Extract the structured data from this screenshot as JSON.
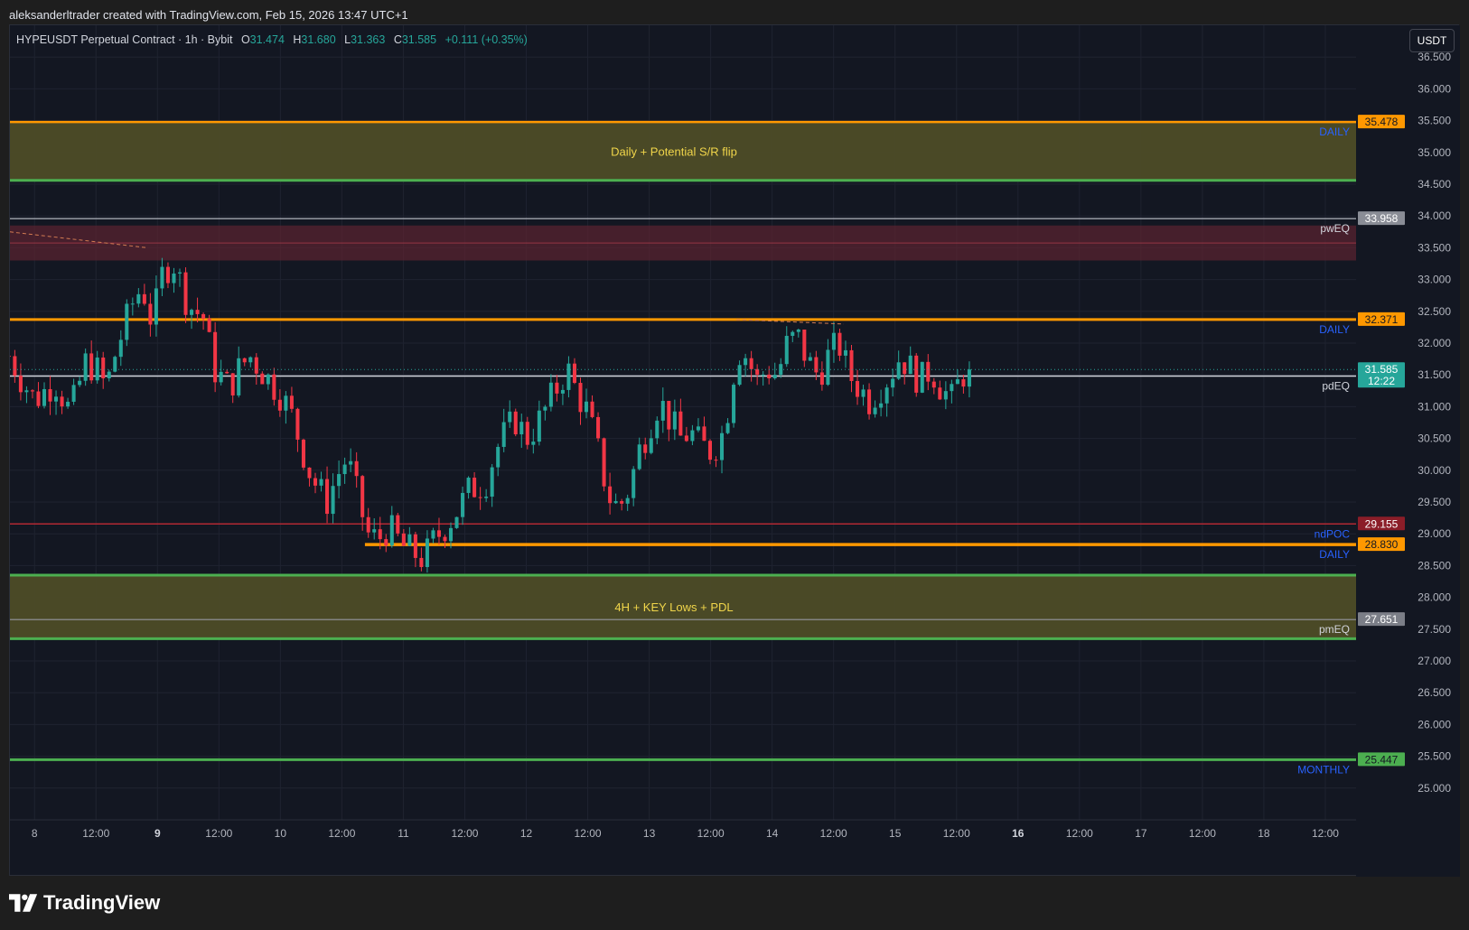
{
  "caption": "aleksanderltrader created with TradingView.com, Feb 15, 2026 13:47 UTC+1",
  "header": {
    "symbol": "HYPEUSDT Perpetual Contract · 1h · Bybit",
    "open_label": "O",
    "open": "31.474",
    "high_label": "H",
    "high": "31.680",
    "low_label": "L",
    "low": "31.363",
    "close_label": "C",
    "close": "31.585",
    "change": "+0.111 (+0.35%)"
  },
  "currency_button": "USDT",
  "brand": {
    "name": "TradingView",
    "icon": "tradingview-logo-icon"
  },
  "colors": {
    "background": "#131722",
    "up": "#26a69a",
    "down": "#f23645",
    "orange": "#ff9800",
    "green": "#4caf50",
    "zone": "#4d4c27",
    "red_zone": "#4a2028",
    "ndpoc": "#8b1d28",
    "daily_text": "#2962ff"
  },
  "chart_data": {
    "type": "candlestick",
    "title": "HYPEUSDT Perpetual Contract · 1h · Bybit",
    "timeframe": "1h",
    "ylim": [
      24.5,
      37.0
    ],
    "y_ticks": [
      "36.500",
      "36.000",
      "35.500",
      "35.000",
      "34.500",
      "34.000",
      "33.500",
      "33.000",
      "32.500",
      "32.000",
      "31.500",
      "31.000",
      "30.500",
      "30.000",
      "29.500",
      "29.000",
      "28.500",
      "28.000",
      "27.500",
      "27.000",
      "26.500",
      "26.000",
      "25.500",
      "25.000"
    ],
    "x_ticks": [
      {
        "label": "8",
        "t": 0,
        "bold": false
      },
      {
        "label": "12:00",
        "t": 12,
        "bold": false
      },
      {
        "label": "9",
        "t": 24,
        "bold": true
      },
      {
        "label": "12:00",
        "t": 36,
        "bold": false
      },
      {
        "label": "10",
        "t": 48,
        "bold": false
      },
      {
        "label": "12:00",
        "t": 60,
        "bold": false
      },
      {
        "label": "11",
        "t": 72,
        "bold": false
      },
      {
        "label": "12:00",
        "t": 84,
        "bold": false
      },
      {
        "label": "12",
        "t": 96,
        "bold": false
      },
      {
        "label": "12:00",
        "t": 108,
        "bold": false
      },
      {
        "label": "13",
        "t": 120,
        "bold": false
      },
      {
        "label": "12:00",
        "t": 132,
        "bold": false
      },
      {
        "label": "14",
        "t": 144,
        "bold": false
      },
      {
        "label": "12:00",
        "t": 156,
        "bold": false
      },
      {
        "label": "15",
        "t": 168,
        "bold": false
      },
      {
        "label": "12:00",
        "t": 180,
        "bold": false
      },
      {
        "label": "16",
        "t": 192,
        "bold": true
      },
      {
        "label": "12:00",
        "t": 204,
        "bold": false
      },
      {
        "label": "17",
        "t": 216,
        "bold": false
      },
      {
        "label": "12:00",
        "t": 228,
        "bold": false
      },
      {
        "label": "18",
        "t": 240,
        "bold": false
      },
      {
        "label": "12:00",
        "t": 252,
        "bold": false
      }
    ],
    "x_range_hours": [
      -4.8,
      258
    ],
    "anchors": [
      [
        -5,
        31.8
      ],
      [
        -3,
        31.5
      ],
      [
        0,
        31.1
      ],
      [
        4,
        31.4
      ],
      [
        7,
        30.9
      ],
      [
        10,
        31.7
      ],
      [
        12,
        31.6
      ],
      [
        14,
        31.3
      ],
      [
        16,
        31.9
      ],
      [
        19,
        32.6
      ],
      [
        21,
        32.9
      ],
      [
        23,
        32.3
      ],
      [
        25,
        33.1
      ],
      [
        27,
        33.3
      ],
      [
        30,
        32.6
      ],
      [
        33,
        32.4
      ],
      [
        35,
        31.6
      ],
      [
        38,
        31.3
      ],
      [
        40,
        31.6
      ],
      [
        42,
        31.8
      ],
      [
        45,
        31.5
      ],
      [
        48,
        31.2
      ],
      [
        50,
        30.9
      ],
      [
        52,
        30.4
      ],
      [
        54,
        29.9
      ],
      [
        57,
        29.5
      ],
      [
        59,
        29.9
      ],
      [
        61,
        30.2
      ],
      [
        63,
        29.6
      ],
      [
        65,
        29.0
      ],
      [
        67,
        28.9
      ],
      [
        69,
        29.1
      ],
      [
        72,
        28.8
      ],
      [
        74,
        28.7
      ],
      [
        76,
        28.6
      ],
      [
        78,
        28.9
      ],
      [
        80,
        29.1
      ],
      [
        82,
        29.3
      ],
      [
        85,
        29.7
      ],
      [
        88,
        29.8
      ],
      [
        90,
        30.3
      ],
      [
        92,
        30.6
      ],
      [
        94,
        30.8
      ],
      [
        96,
        30.5
      ],
      [
        98,
        30.7
      ],
      [
        100,
        31.0
      ],
      [
        102,
        31.3
      ],
      [
        104,
        31.6
      ],
      [
        106,
        31.2
      ],
      [
        108,
        30.9
      ],
      [
        110,
        30.3
      ],
      [
        112,
        29.6
      ],
      [
        114,
        29.4
      ],
      [
        116,
        29.7
      ],
      [
        118,
        30.3
      ],
      [
        120,
        30.7
      ],
      [
        122,
        31.1
      ],
      [
        124,
        30.8
      ],
      [
        126,
        30.5
      ],
      [
        128,
        30.6
      ],
      [
        130,
        30.4
      ],
      [
        132,
        30.3
      ],
      [
        134,
        30.5
      ],
      [
        136,
        31.2
      ],
      [
        137,
        31.9
      ],
      [
        139,
        31.8
      ],
      [
        141,
        31.4
      ],
      [
        143,
        31.6
      ],
      [
        145,
        31.5
      ],
      [
        147,
        32.0
      ],
      [
        149,
        32.1
      ],
      [
        151,
        31.7
      ],
      [
        153,
        31.5
      ],
      [
        155,
        31.8
      ],
      [
        157,
        32.0
      ],
      [
        159,
        31.5
      ],
      [
        161,
        31.3
      ],
      [
        163,
        31.1
      ],
      [
        165,
        31.3
      ],
      [
        167,
        31.5
      ],
      [
        169,
        31.8
      ],
      [
        171,
        31.6
      ],
      [
        173,
        31.4
      ],
      [
        175,
        31.6
      ],
      [
        177,
        31.3
      ],
      [
        179,
        31.1
      ],
      [
        181,
        31.5
      ],
      [
        182.5,
        31.585
      ]
    ],
    "candle_count": 164,
    "last": {
      "price": "31.585",
      "countdown": "12:22"
    },
    "levels": [
      {
        "price": 35.478,
        "label": "35.478",
        "tag": "DAILY",
        "color": "#ff9800",
        "style": "solid",
        "width": 2.5,
        "from_t": -5
      },
      {
        "price": 34.56,
        "label": "",
        "tag": "",
        "color": "#4caf50",
        "style": "solid",
        "width": 3,
        "from_t": -5
      },
      {
        "price": 33.958,
        "label": "33.958",
        "tag": "pwEQ",
        "color": "#b2b5be",
        "style": "solid",
        "width": 1.2,
        "from_t": -5
      },
      {
        "price": 32.371,
        "label": "32.371",
        "tag": "DAILY",
        "color": "#ff9800",
        "style": "solid",
        "width": 3,
        "from_t": -5
      },
      {
        "price": 31.482,
        "label": "31.482",
        "tag": "pdEQ",
        "color": "#d1d4dc",
        "style": "solid",
        "width": 1.5,
        "from_t": -5
      },
      {
        "price": 29.155,
        "label": "29.155",
        "tag": "ndPOC",
        "color": "#b22833",
        "style": "solid",
        "width": 1.5,
        "from_t": -5
      },
      {
        "price": 28.83,
        "label": "28.830",
        "tag": "DAILY",
        "color": "#ff9800",
        "style": "solid",
        "width": 3.5,
        "from_t": 64.5
      },
      {
        "price": 28.35,
        "label": "",
        "tag": "",
        "color": "#4caf50",
        "style": "solid",
        "width": 3,
        "from_t": -5
      },
      {
        "price": 27.651,
        "label": "27.651",
        "tag": "pmEQ",
        "color": "#9598a1",
        "style": "solid",
        "width": 1.2,
        "from_t": -5
      },
      {
        "price": 27.35,
        "label": "",
        "tag": "",
        "color": "#4caf50",
        "style": "solid",
        "width": 3,
        "from_t": -5
      },
      {
        "price": 25.447,
        "label": "25.447",
        "tag": "MONTHLY",
        "color": "#4caf50",
        "style": "solid",
        "width": 3,
        "from_t": -5
      }
    ],
    "zones": [
      {
        "top": 35.48,
        "bottom": 34.56,
        "color": "#4d4c27",
        "opacity": 0.95,
        "text": "Daily + Potential S/R flip"
      },
      {
        "top": 33.85,
        "bottom": 33.3,
        "color": "#5c2330",
        "opacity": 0.7,
        "text": ""
      },
      {
        "top": 28.35,
        "bottom": 27.35,
        "color": "#4d4c27",
        "opacity": 0.95,
        "text": "4H + KEY  Lows + PDL"
      }
    ]
  }
}
